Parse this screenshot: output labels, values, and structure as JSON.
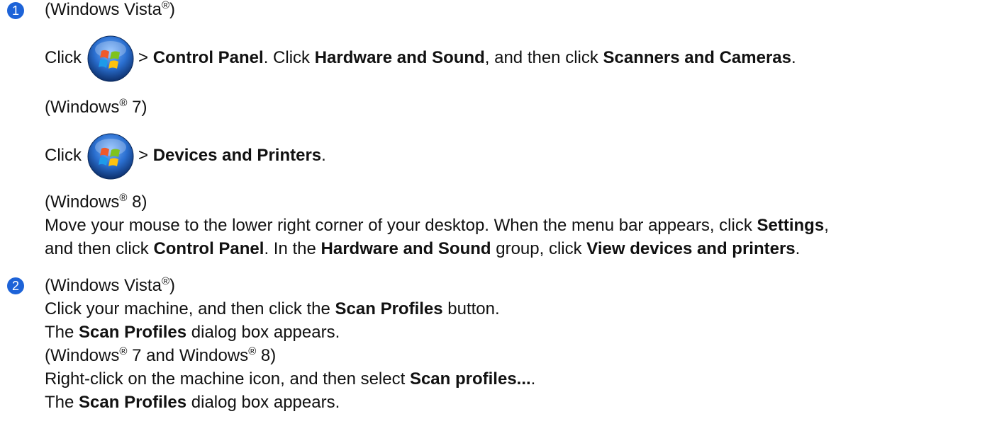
{
  "step1": {
    "number": "1",
    "vista_heading_prefix": "(Windows Vista",
    "reg_mark": "®",
    "heading_close": ")",
    "vista_click": "Click",
    "vista_gt": ">",
    "vista_control_panel": "Control Panel",
    "vista_mid1": ". Click",
    "vista_hardware_sound": "Hardware and Sound",
    "vista_mid2": ", and then click",
    "vista_scanners_cameras": "Scanners and Cameras",
    "period": ".",
    "win7_heading_prefix": "(Windows",
    "win7_heading_suffix": " 7)",
    "win7_click": "Click",
    "win7_gt": ">",
    "win7_devices_printers": "Devices and Printers",
    "win8_heading_prefix": "(Windows",
    "win8_heading_suffix": " 8)",
    "win8_line1": "Move your mouse to the lower right corner of your desktop. When the menu bar appears, click",
    "win8_settings": "Settings",
    "win8_comma": ",",
    "win8_line2_a": "and then click",
    "win8_control_panel": "Control Panel",
    "win8_line2_b": ". In the",
    "win8_hardware_sound": "Hardware and Sound",
    "win8_line2_c": "group, click",
    "win8_view_devices": "View devices and printers"
  },
  "step2": {
    "number": "2",
    "vista_heading_prefix": "(Windows Vista",
    "vista_line1_a": "Click your machine, and then click the",
    "scan_profiles": "Scan Profiles",
    "vista_line1_b": "button.",
    "the": "The",
    "dialog_appears": "dialog box appears.",
    "win78_heading_a": "(Windows",
    "win78_heading_b": " 7 and Windows",
    "win78_heading_c": " 8)",
    "win78_line1_a": "Right-click on the machine icon, and then select",
    "scan_profiles_menu": "Scan profiles...",
    "win78_line1_b": "."
  },
  "icons": {
    "start_button": "windows-start-orb-icon"
  }
}
